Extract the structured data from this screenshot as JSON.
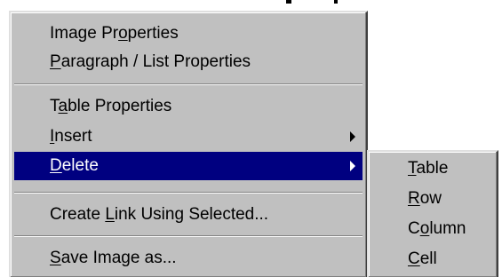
{
  "context_menu": {
    "items": [
      {
        "label": "Image Properties",
        "pre": "Image Pr",
        "acc": "o",
        "post": "perties"
      },
      {
        "label": "Paragraph / List Properties",
        "pre": "",
        "acc": "P",
        "post": "aragraph / List Properties"
      },
      {
        "label": "Table Properties",
        "pre": "T",
        "acc": "a",
        "post": "ble Properties"
      },
      {
        "label": "Insert",
        "pre": "",
        "acc": "I",
        "post": "nsert"
      },
      {
        "label": "Delete",
        "pre": "",
        "acc": "D",
        "post": "elete"
      },
      {
        "label": "Create Link Using Selected...",
        "pre": "Create ",
        "acc": "L",
        "post": "ink Using Selected..."
      },
      {
        "label": "Save Image as...",
        "pre": "",
        "acc": "S",
        "post": "ave Image as..."
      }
    ],
    "highlighted": "Delete"
  },
  "delete_submenu": {
    "items": [
      {
        "label": "Table",
        "pre": "",
        "acc": "T",
        "post": "able"
      },
      {
        "label": "Row",
        "pre": "",
        "acc": "R",
        "post": "ow"
      },
      {
        "label": "Column",
        "pre": "C",
        "acc": "o",
        "post": "lumn"
      },
      {
        "label": "Cell",
        "pre": "",
        "acc": "C",
        "post": "ell"
      }
    ]
  },
  "colors": {
    "menu_face": "#c0c0c0",
    "highlight": "#000080",
    "highlight_text": "#ffffff"
  },
  "icons": {
    "submenu_arrow": "chevron-right-icon"
  }
}
